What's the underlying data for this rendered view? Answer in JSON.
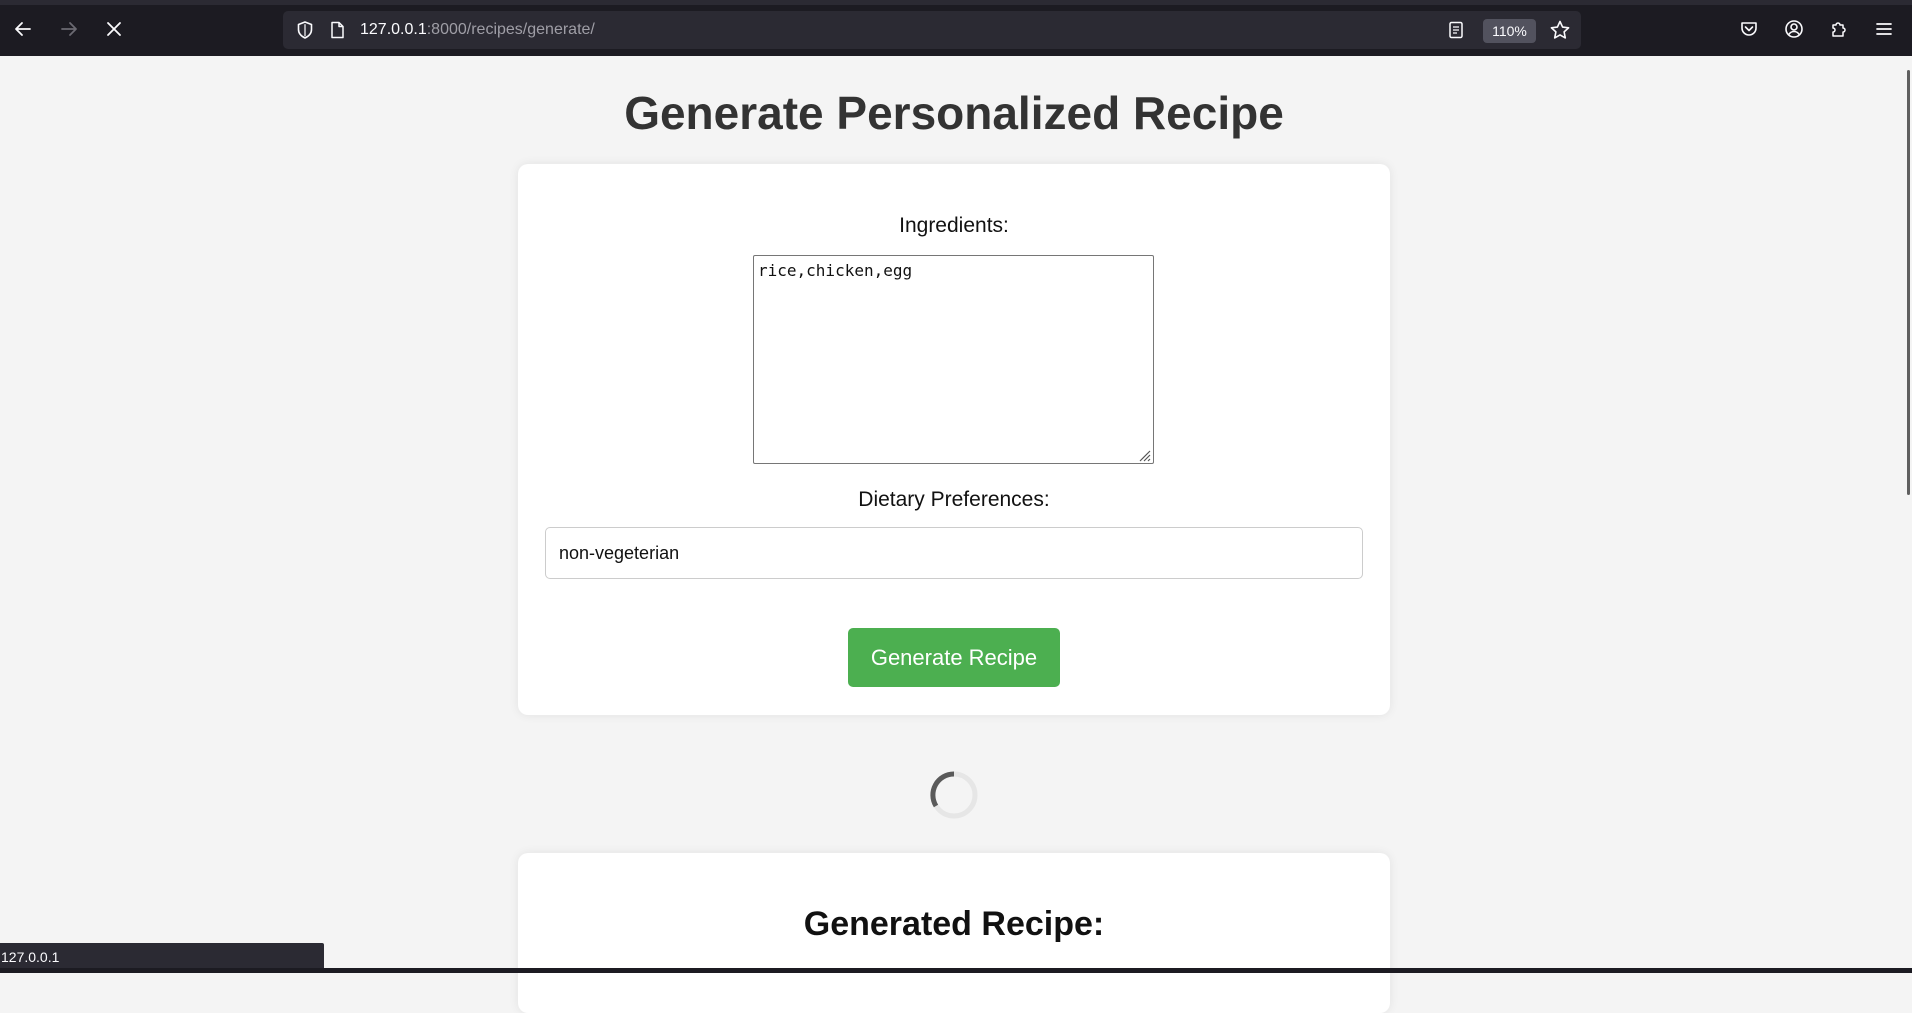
{
  "browser": {
    "url_host": "127.0.0.1",
    "url_path": ":8000/recipes/generate/",
    "zoom": "110%",
    "status_text": "127.0.0.1",
    "icons": [
      "back-icon",
      "forward-icon",
      "stop-icon",
      "shield-icon",
      "page-icon",
      "reader-view-icon",
      "bookmark-star-icon",
      "pocket-icon",
      "account-icon",
      "extensions-icon",
      "menu-icon"
    ]
  },
  "page": {
    "title": "Generate Personalized Recipe",
    "form": {
      "ingredients_label": "Ingredients:",
      "ingredients_value": "rice,chicken,egg",
      "dietary_label": "Dietary Preferences:",
      "dietary_value": "non-vegeterian",
      "submit_label": "Generate Recipe"
    },
    "result": {
      "title": "Generated Recipe:"
    },
    "colors": {
      "button": "#4caf50",
      "background": "#f4f4f4",
      "heading": "#333333"
    }
  }
}
